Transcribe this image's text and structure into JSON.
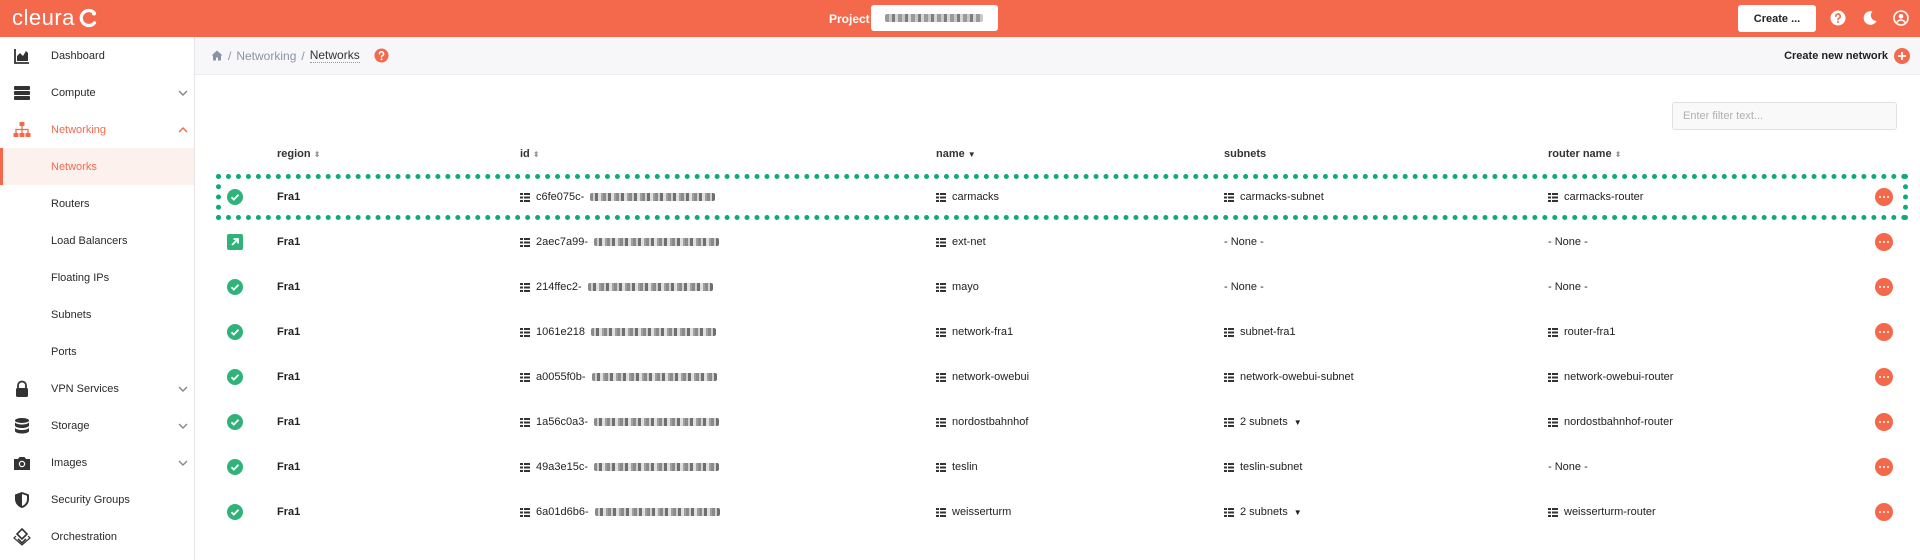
{
  "topbar": {
    "logo": "cleura",
    "project_label": "Project",
    "create_button": "Create ..."
  },
  "sidebar": {
    "items": [
      {
        "label": "Dashboard",
        "icon": "chart-area-icon"
      },
      {
        "label": "Compute",
        "icon": "server-icon"
      },
      {
        "label": "Networking",
        "icon": "network-icon"
      },
      {
        "label": "VPN Services",
        "icon": "lock-icon"
      },
      {
        "label": "Storage",
        "icon": "database-icon"
      },
      {
        "label": "Images",
        "icon": "camera-icon"
      },
      {
        "label": "Security Groups",
        "icon": "shield-icon"
      },
      {
        "label": "Orchestration",
        "icon": "orchestration-icon"
      }
    ],
    "networking_sub": [
      "Networks",
      "Routers",
      "Load Balancers",
      "Floating IPs",
      "Subnets",
      "Ports"
    ]
  },
  "breadcrumb": [
    "Networking",
    "Networks"
  ],
  "create_new_network": "Create new network",
  "filter_placeholder": "Enter filter text...",
  "columns": [
    "region",
    "id",
    "name",
    "subnets",
    "router name"
  ],
  "rows": [
    {
      "status": "active",
      "region": "Fra1",
      "id": "c6fe075c-",
      "name": "carmacks",
      "subnets": "carmacks-subnet",
      "router": "carmacks-router"
    },
    {
      "status": "external",
      "region": "Fra1",
      "id": "2aec7a99-",
      "name": "ext-net",
      "subnets": "- None -",
      "router": "- None -"
    },
    {
      "status": "active",
      "region": "Fra1",
      "id": "214ffec2-",
      "name": "mayo",
      "subnets": "- None -",
      "router": "- None -"
    },
    {
      "status": "active",
      "region": "Fra1",
      "id": "1061e218",
      "name": "network-fra1",
      "subnets": "subnet-fra1",
      "router": "router-fra1"
    },
    {
      "status": "active",
      "region": "Fra1",
      "id": "a0055f0b-",
      "name": "network-owebui",
      "subnets": "network-owebui-subnet",
      "router": "network-owebui-router"
    },
    {
      "status": "active",
      "region": "Fra1",
      "id": "1a56c0a3-",
      "name": "nordostbahnhof",
      "subnets": "2 subnets",
      "router": "nordostbahnhof-router"
    },
    {
      "status": "active",
      "region": "Fra1",
      "id": "49a3e15c-",
      "name": "teslin",
      "subnets": "teslin-subnet",
      "router": "- None -"
    },
    {
      "status": "active",
      "region": "Fra1",
      "id": "6a01d6b6-",
      "name": "weisserturm",
      "subnets": "2 subnets",
      "router": "weisserturm-router"
    }
  ],
  "colors": {
    "brand": "#f4694c",
    "success": "#2fb37a",
    "highlight": "#0faa7c"
  }
}
